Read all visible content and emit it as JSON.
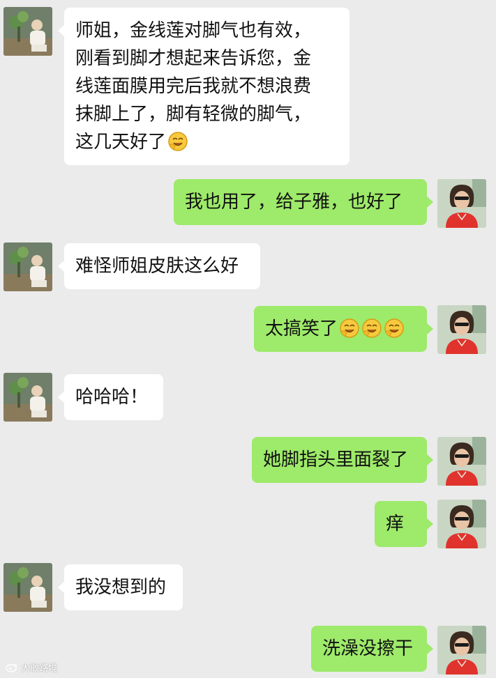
{
  "messages": [
    {
      "side": "left",
      "text": "师姐，金线莲对脚气也有效，\n刚看到脚才想起来告诉您，金\n线莲面膜用完后我就不想浪费\n抹脚上了，脚有轻微的脚气，\n这几天好了",
      "emojis": [
        "grin-hand-emoji"
      ]
    },
    {
      "side": "right",
      "text": "我也用了，给子雅，也好了",
      "emojis": []
    },
    {
      "side": "left",
      "text": "难怪师姐皮肤这么好",
      "emojis": []
    },
    {
      "side": "right",
      "text": "太搞笑了",
      "emojis": [
        "grin-hand-emoji",
        "grin-hand-emoji",
        "grin-hand-emoji"
      ]
    },
    {
      "side": "left",
      "text": "哈哈哈！",
      "emojis": []
    },
    {
      "side": "right",
      "text": "她脚指头里面裂了",
      "emojis": []
    },
    {
      "side": "right",
      "text": "痒",
      "emojis": []
    },
    {
      "side": "left",
      "text": "我没想到的",
      "emojis": []
    },
    {
      "side": "right",
      "text": "洗澡没擦干",
      "emojis": []
    }
  ],
  "watermark": {
    "text": "大敢路境",
    "icon": "weibo-icon"
  },
  "colors": {
    "background": "#ebebeb",
    "incoming_bubble": "#ffffff",
    "outgoing_bubble": "#9eea6a"
  }
}
